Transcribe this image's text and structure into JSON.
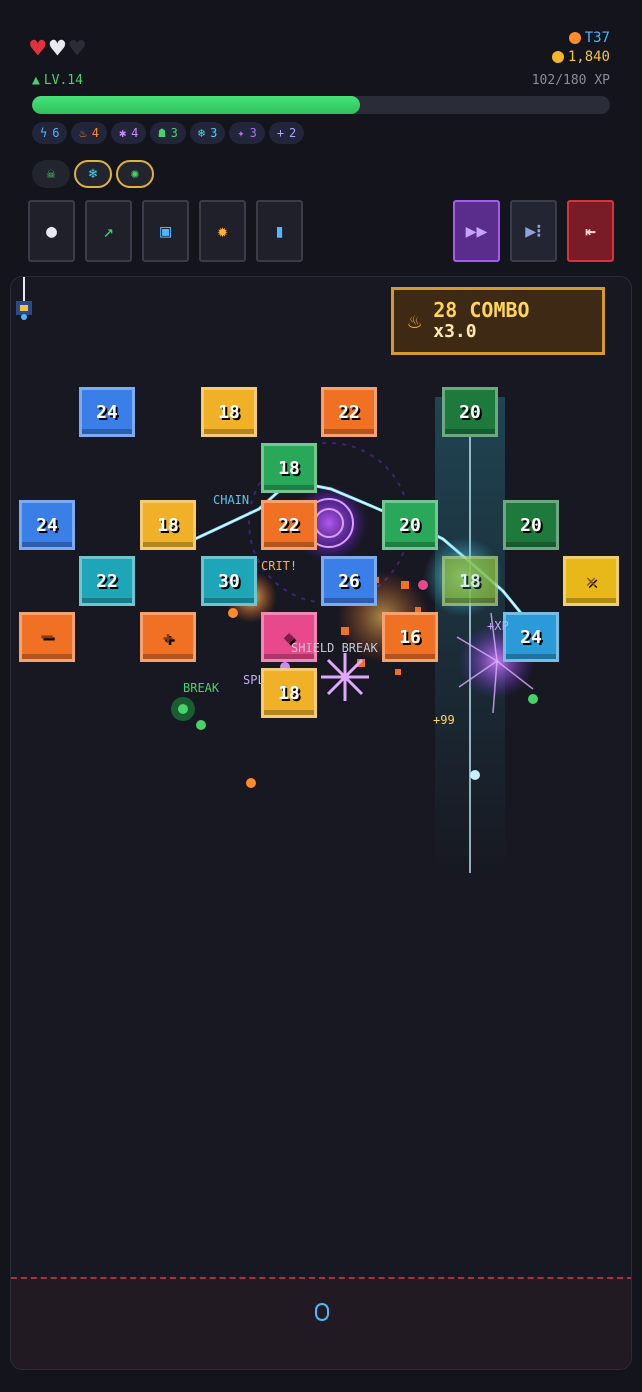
{
  "hud": {
    "hearts": [
      "full",
      "half",
      "empty"
    ],
    "turn": "T37",
    "coins": "1,840",
    "level": "LV.14",
    "xp_text": "102/180 XP",
    "xp_progress": 0.567
  },
  "stats": [
    {
      "icon": "bolt-icon",
      "value": "6",
      "color": "#4fb6ff"
    },
    {
      "icon": "flame-icon",
      "value": "4",
      "color": "#ff8b2a"
    },
    {
      "icon": "sparkle-icon",
      "value": "4",
      "color": "#c88cff"
    },
    {
      "icon": "poison-icon",
      "value": "3",
      "color": "#47d26a"
    },
    {
      "icon": "frost-icon",
      "value": "3",
      "color": "#4fd6e8"
    },
    {
      "icon": "void-icon",
      "value": "3",
      "color": "#b06cff"
    },
    {
      "icon": "plus-icon",
      "value": "2",
      "color": "#a8a8ff"
    }
  ],
  "relics": [
    {
      "icon": "skull-relic-icon",
      "gold": false
    },
    {
      "icon": "frost-relic-icon",
      "gold": true
    },
    {
      "icon": "bug-relic-icon",
      "gold": true
    }
  ],
  "abilities": [
    {
      "icon": "penguin-icon"
    },
    {
      "icon": "chart-icon"
    },
    {
      "icon": "screen-icon"
    },
    {
      "icon": "sun-icon"
    },
    {
      "icon": "ghost-icon"
    }
  ],
  "controls": [
    {
      "icon": "fast-forward-icon",
      "type": "speed"
    },
    {
      "icon": "step-icon",
      "type": "step"
    },
    {
      "icon": "exit-icon",
      "type": "exit"
    }
  ],
  "combo": {
    "count_label": "28 COMBO",
    "multiplier": "x3.0"
  },
  "bricks": [
    {
      "label": "24",
      "color": "#3a7ee8"
    },
    {
      "label": "18",
      "color": "#f0b028"
    },
    {
      "label": "22",
      "color": "#f07024"
    },
    {
      "label": "20",
      "color": "#1e7a3c"
    },
    {
      "label": "18",
      "color": "#2aa85a"
    },
    {
      "label": "24",
      "color": "#3a7ee8"
    },
    {
      "label": "18",
      "color": "#f0b028"
    },
    {
      "label": "22",
      "color": "#f07024"
    },
    {
      "label": "20",
      "color": "#2aa85a"
    },
    {
      "label": "20",
      "color": "#1e7a3c"
    },
    {
      "label": "22",
      "color": "#1ea6b8"
    },
    {
      "label": "30",
      "color": "#1ea6b8"
    },
    {
      "label": "26",
      "color": "#3a7ee8"
    },
    {
      "label": "18",
      "color": "#88b838"
    },
    {
      "label": "",
      "color": "#e8b818"
    },
    {
      "label": "",
      "color": "#f07024"
    },
    {
      "label": "",
      "color": "#f07024"
    },
    {
      "label": "",
      "color": "#e8488c"
    },
    {
      "label": "16",
      "color": "#f07024"
    },
    {
      "label": "24",
      "color": "#2a9ad8"
    },
    {
      "label": "18",
      "color": "#f0b028"
    }
  ],
  "float_texts": [
    {
      "text": "CHAIN",
      "color": "#5ac8e8"
    },
    {
      "text": "CRIT!",
      "color": "#ffb13a"
    },
    {
      "text": "SHIELD BREAK",
      "color": "#c8c8d8"
    },
    {
      "text": "BREAK",
      "color": "#47d26a"
    },
    {
      "text": "SPL",
      "color": "#c8a8ff"
    },
    {
      "text": "+99",
      "color": "#ffd45a"
    },
    {
      "text": "+XP",
      "color": "#c8a8ff"
    }
  ]
}
